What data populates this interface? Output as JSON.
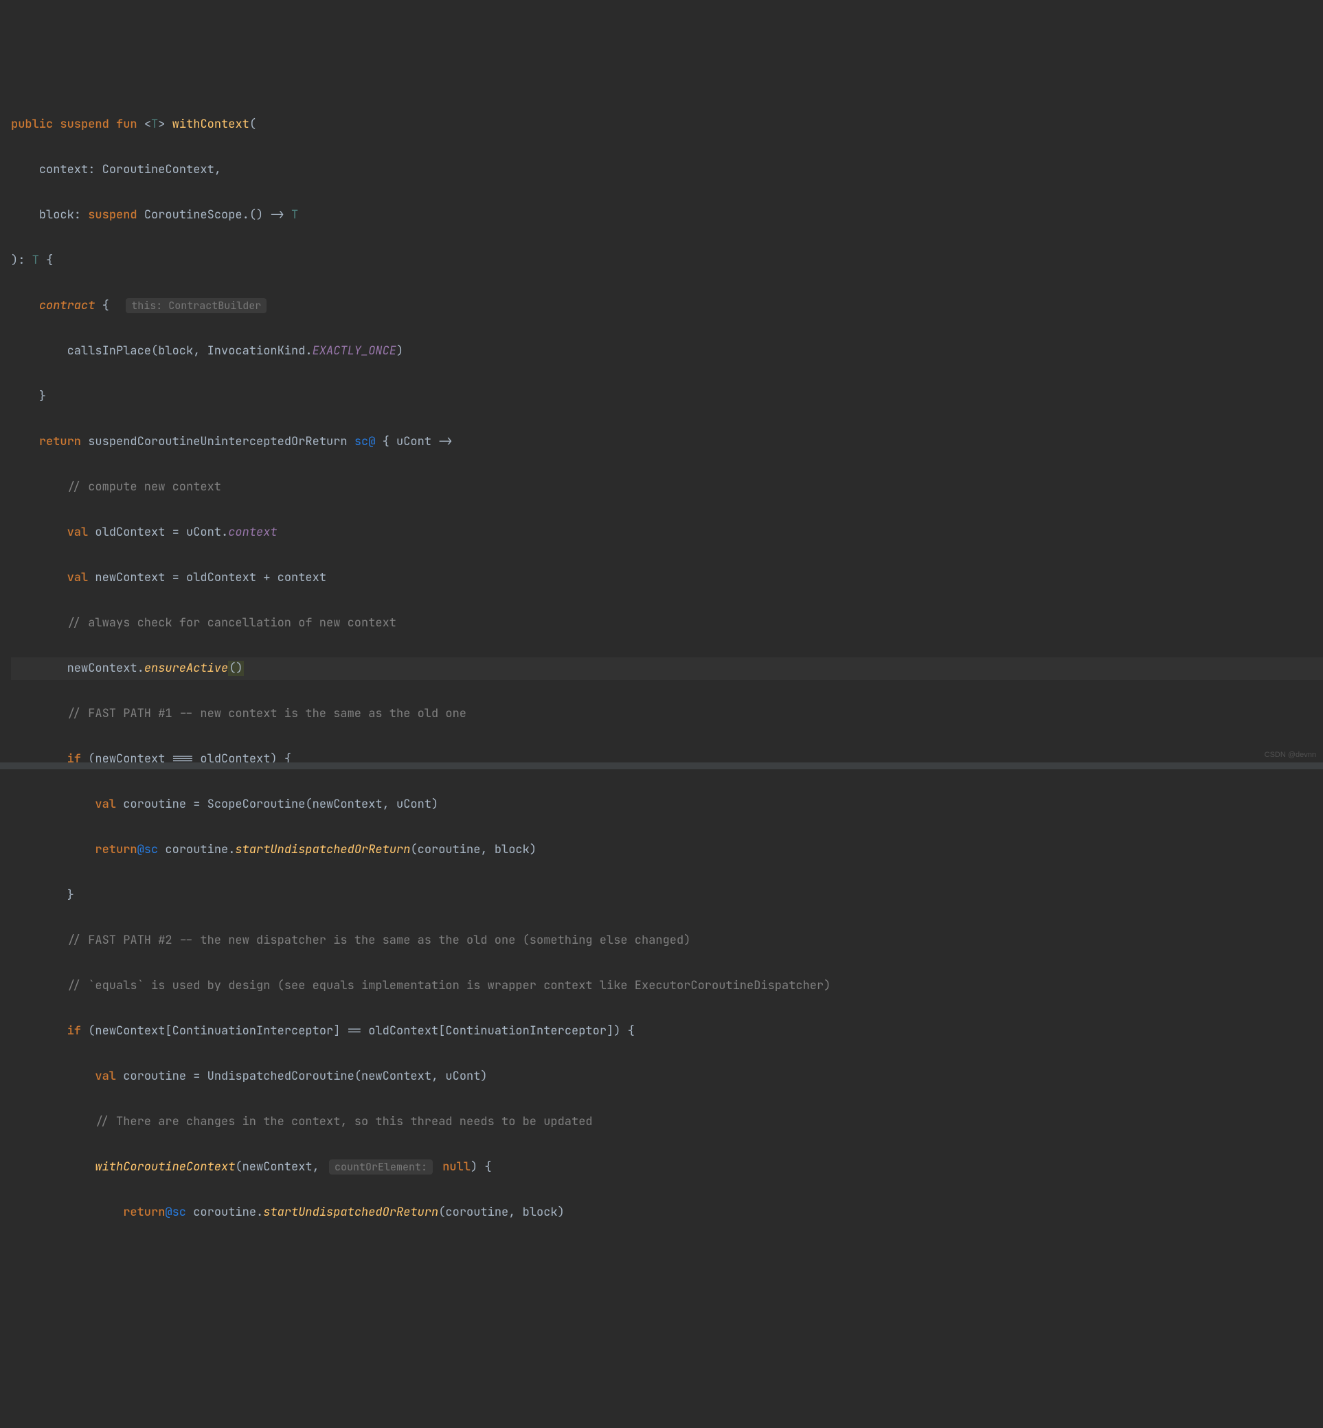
{
  "code": {
    "l1_public": "public",
    "l1_suspend": "suspend",
    "l1_fun": "fun",
    "l1_lt": "<",
    "l1_T": "T",
    "l1_gt": ">",
    "l1_name": "withContext",
    "l1_paren": "(",
    "l2_param": "context: ",
    "l2_type": "CoroutineContext",
    "l2_comma": ",",
    "l3_param": "block: ",
    "l3_suspend": "suspend",
    "l3_rest": " CoroutineScope.() -> ",
    "l3_T": "T",
    "l4_close": "): ",
    "l4_T": "T",
    "l4_brace": " {",
    "l5_contract": "contract",
    "l5_brace": " {",
    "l5_hint": "this: ContractBuilder",
    "l6_calls": "callsInPlace(block, InvocationKind.",
    "l6_exactly": "EXACTLY_ONCE",
    "l6_close": ")",
    "l7_brace": "}",
    "l8_return": "return",
    "l8_fn": " suspendCoroutineUninterceptedOrReturn ",
    "l8_label": "sc@",
    "l8_rest": " { uCont ->",
    "l9_comment": "// compute new context",
    "l10_val": "val",
    "l10_rest": " oldContext = uCont.",
    "l10_ctx": "context",
    "l11_val": "val",
    "l11_rest": " newContext = oldContext + context",
    "l12_comment": "// always check for cancellation of new context",
    "l13_obj": "newContext.",
    "l13_method": "ensureActive",
    "l13_parens": "()",
    "l14_comment": "// FAST PATH #1 -- new context is the same as the old one",
    "l15_if": "if",
    "l15_cond": " (newContext === oldContext) {",
    "l16_val": "val",
    "l16_rest": " coroutine = ScopeCoroutine(newContext, uCont)",
    "l17_return": "return",
    "l17_label": "@sc",
    "l17_rest": " coroutine.",
    "l17_method": "startUndispatchedOrReturn",
    "l17_args": "(coroutine, block)",
    "l18_brace": "}",
    "l19_comment": "// FAST PATH #2 -- the new dispatcher is the same as the old one (something else changed)",
    "l20_comment": "// `equals` is used by design (see equals implementation is wrapper context like ExecutorCoroutineDispatcher)",
    "l21_if": "if",
    "l21_cond": " (newContext[ContinuationInterceptor] == oldContext[ContinuationInterceptor]) {",
    "l22_val": "val",
    "l22_rest": " coroutine = UndispatchedCoroutine(newContext, uCont)",
    "l23_comment": "// There are changes in the context, so this thread needs to be updated",
    "l24_method": "withCoroutineContext",
    "l24_open": "(newContext, ",
    "l24_hint": "countOrElement:",
    "l24_null": " null",
    "l24_close": ") {",
    "l25_return": "return",
    "l25_label": "@sc",
    "l25_rest": " coroutine.",
    "l25_method": "startUndispatchedOrReturn",
    "l25_args": "(coroutine, block)"
  },
  "watermark": "CSDN @devnn"
}
